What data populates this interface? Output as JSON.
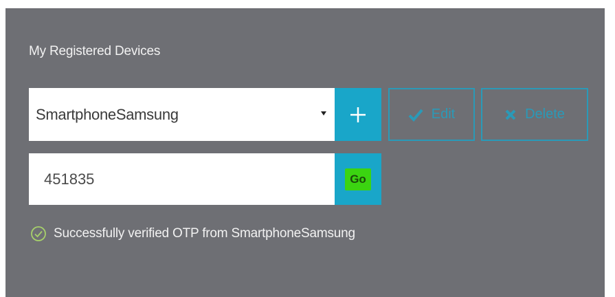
{
  "section": {
    "title": "My Registered Devices"
  },
  "device_select": {
    "selected": "SmartphoneSamsung"
  },
  "actions": {
    "add_icon": "plus-icon",
    "edit_label": "Edit",
    "edit_icon": "checkmark-icon",
    "delete_label": "Delete",
    "delete_icon": "x-icon"
  },
  "otp": {
    "value": "451835",
    "go_label": "Go"
  },
  "status": {
    "icon": "check-circle-icon",
    "message": "Successfully verified OTP from SmartphoneSamsung"
  },
  "colors": {
    "panel_bg": "#6e6f74",
    "accent": "#19a6c9",
    "go_button": "#3bd411",
    "success": "#a7d16b"
  }
}
